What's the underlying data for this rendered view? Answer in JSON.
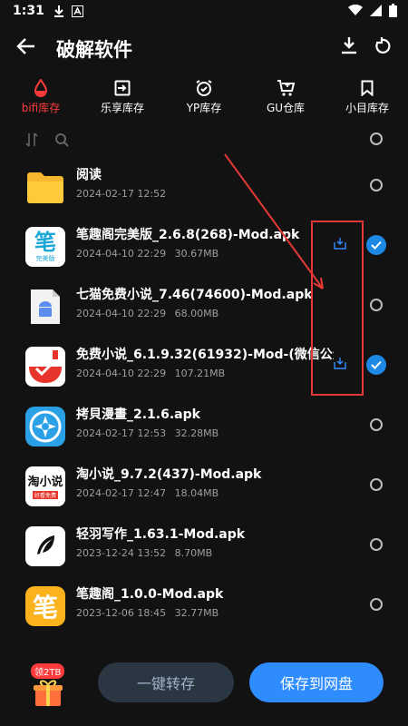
{
  "status": {
    "time": "1:31",
    "icons": [
      "download-icon",
      "a-icon",
      "wifi-icon",
      "signal-icon",
      "battery-icon"
    ]
  },
  "header": {
    "title": "破解软件",
    "back_icon": "arrow-left-icon",
    "download_icon": "download-icon",
    "refresh_icon": "refresh-icon"
  },
  "tabs": [
    {
      "label": "bifi库存",
      "icon": "drop-icon",
      "active": true
    },
    {
      "label": "乐享库存",
      "icon": "login-box-icon",
      "active": false
    },
    {
      "label": "YP库存",
      "icon": "alarm-clock-icon",
      "active": false
    },
    {
      "label": "GU仓库",
      "icon": "cart-icon",
      "active": false
    },
    {
      "label": "小目库存",
      "icon": "bookmark-icon",
      "active": false
    }
  ],
  "files": [
    {
      "name": "阅读",
      "date": "2024-02-17 12:52",
      "size": "",
      "type": "folder",
      "checked": false
    },
    {
      "name": "笔趣阁完美版_2.6.8(268)-Mod.apk",
      "date": "2024-04-10 22:29",
      "size": "30.67MB",
      "type": "apk",
      "checked": true
    },
    {
      "name": "七猫免费小说_7.46(74600)-Mod.apk",
      "date": "2024-04-10 22:29",
      "size": "68.00MB",
      "type": "apk",
      "checked": false
    },
    {
      "name": "免费小说_6.1.9.32(61932)-Mod-(微信公众",
      "date": "2024-04-10 22:29",
      "size": "107.21MB",
      "type": "apk",
      "checked": true
    },
    {
      "name": "拷貝漫畫_2.1.6.apk",
      "date": "2024-02-17 12:53",
      "size": "32.28MB",
      "type": "apk",
      "checked": false
    },
    {
      "name": "淘小说_9.7.2(437)-Mod.apk",
      "date": "2024-02-17 12:47",
      "size": "18.04MB",
      "type": "apk",
      "checked": false
    },
    {
      "name": "轻羽写作_1.63.1-Mod.apk",
      "date": "2023-12-24 13:52",
      "size": "8.70MB",
      "type": "apk",
      "checked": false
    },
    {
      "name": "笔趣阁_1.0.0-Mod.apk",
      "date": "2023-12-06 18:45",
      "size": "32.77MB",
      "type": "apk",
      "checked": false
    }
  ],
  "thumb_text": {
    "biquge_sub": "完美版",
    "taoxiaoshuo": "淘小说",
    "taoxiaoshuo_sub": "好看免费",
    "biquge": "笔"
  },
  "bottom": {
    "gift_badge": "领2TB",
    "transfer_label": "一键转存",
    "save_label": "保存到网盘"
  },
  "colors": {
    "accent_red": "#ff3b3b",
    "primary_blue": "#2f8cff",
    "background": "#121212"
  }
}
